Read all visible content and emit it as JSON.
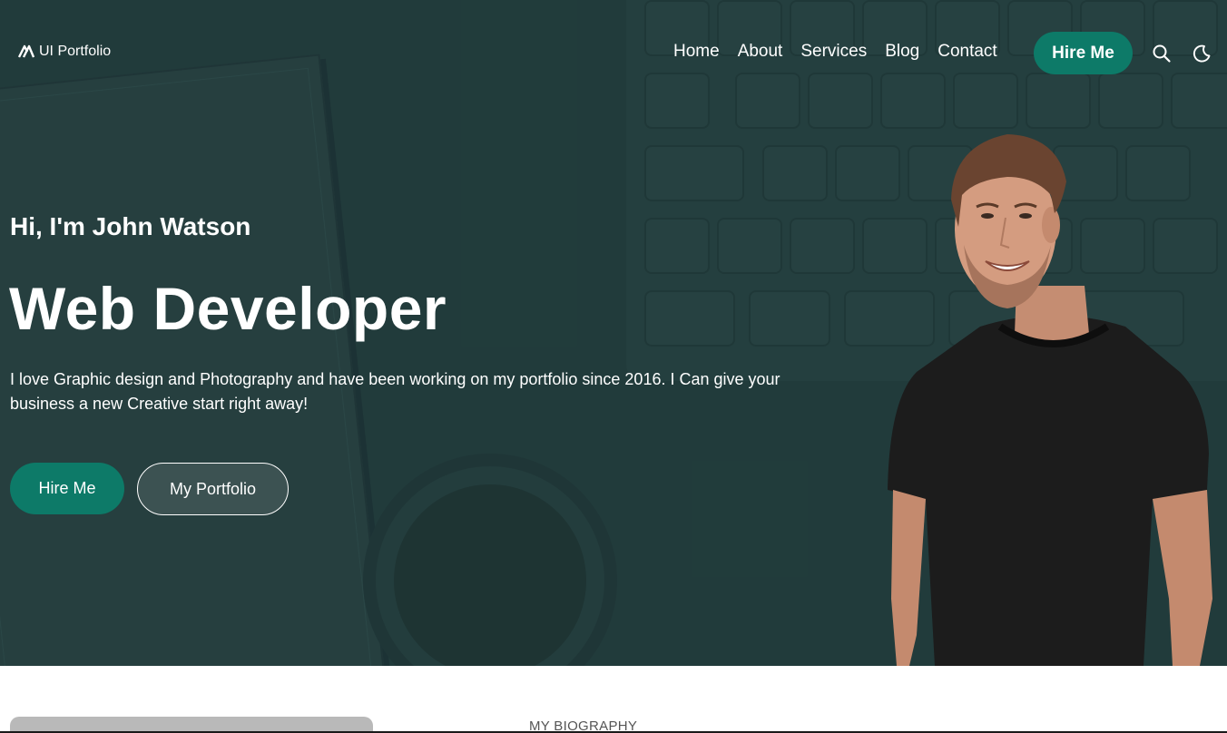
{
  "nav": {
    "logo_text": "UI Portfolio",
    "links": [
      "Home",
      "About",
      "Services",
      "Blog",
      "Contact"
    ],
    "hire_label": "Hire Me",
    "icons": [
      "search-icon",
      "moon-icon"
    ]
  },
  "hero": {
    "greeting": "Hi, I'm John Watson",
    "role": "Web Developer",
    "intro": "I love Graphic design and Photography and have been working on my portfolio since 2016. I Can give your business a new Creative start right away!",
    "primary_button": "Hire Me",
    "secondary_button": "My Portfolio"
  },
  "bio": {
    "label": "MY BIOGRAPHY"
  },
  "colors": {
    "accent": "#0d7a68",
    "hero_bg": "#27413f",
    "text": "#ffffff"
  }
}
